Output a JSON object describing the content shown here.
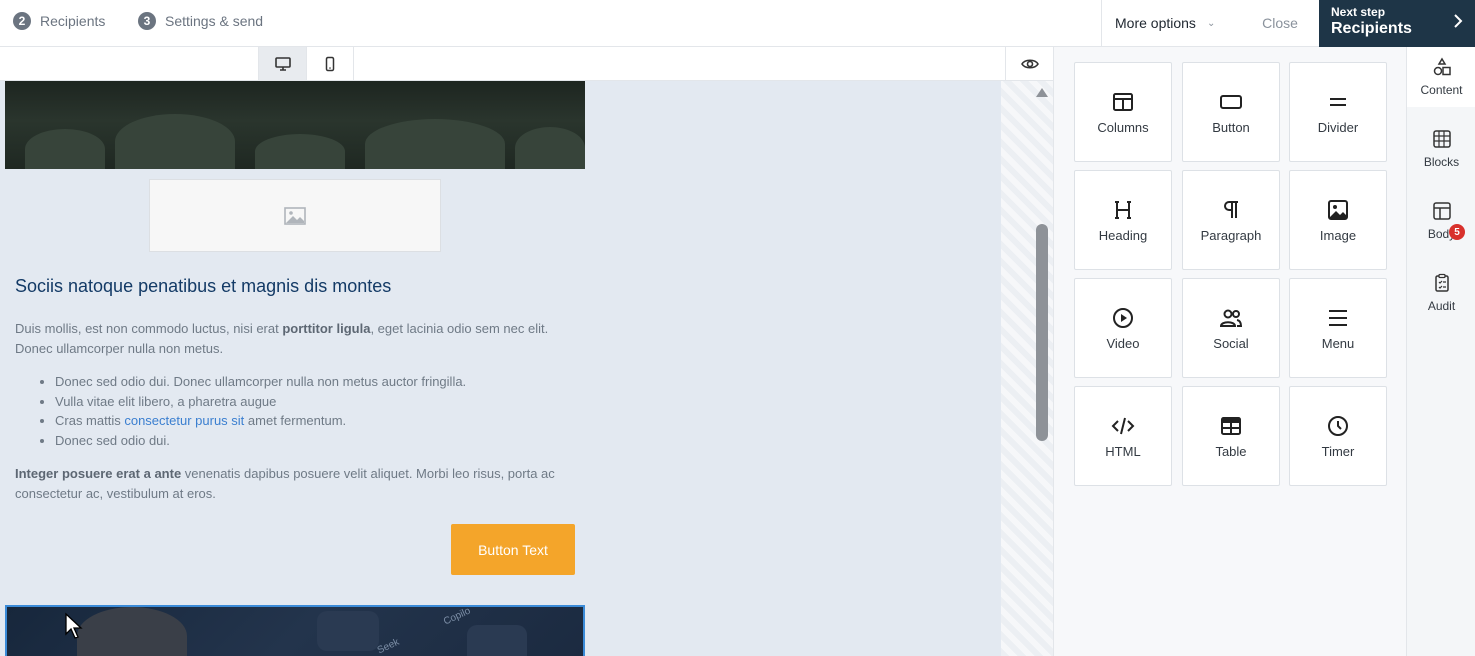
{
  "steps": [
    {
      "number": "2",
      "label": "Recipients"
    },
    {
      "number": "3",
      "label": "Settings & send"
    }
  ],
  "header": {
    "more_options_label": "More options",
    "close_label": "Close",
    "next_step_small": "Next step",
    "next_step_big": "Recipients"
  },
  "email": {
    "heading": "Sociis natoque penatibus et magnis dis montes",
    "para1_before": "Duis mollis, est non commodo luctus, nisi erat ",
    "para1_bold": "porttitor ligula",
    "para1_after": ", eget lacinia odio sem nec elit. Donec ullamcorper nulla non metus.",
    "list": {
      "item1": "Donec sed odio dui. Donec ullamcorper nulla non metus auctor fringilla.",
      "item2": "Vulla vitae elit libero, a pharetra augue",
      "item3_before": "Cras mattis ",
      "item3_link": "consectetur purus sit",
      "item3_after": " amet fermentum.",
      "item4": "Donec sed odio dui."
    },
    "para2_bold": "Integer posuere erat a ante",
    "para2_after": " venenatis dapibus posuere velit aliquet. Morbi leo risus, porta ac consectetur ac, vestibulum at eros.",
    "button_text": "Button Text",
    "image_tags": [
      "Seek",
      "Copilo"
    ]
  },
  "blocks": [
    {
      "label": "Columns",
      "icon": "columns-icon"
    },
    {
      "label": "Button",
      "icon": "button-icon"
    },
    {
      "label": "Divider",
      "icon": "divider-icon"
    },
    {
      "label": "Heading",
      "icon": "heading-icon"
    },
    {
      "label": "Paragraph",
      "icon": "paragraph-icon"
    },
    {
      "label": "Image",
      "icon": "image-icon"
    },
    {
      "label": "Video",
      "icon": "video-icon"
    },
    {
      "label": "Social",
      "icon": "social-icon"
    },
    {
      "label": "Menu",
      "icon": "menu-icon"
    },
    {
      "label": "HTML",
      "icon": "html-icon"
    },
    {
      "label": "Table",
      "icon": "table-icon"
    },
    {
      "label": "Timer",
      "icon": "timer-icon"
    }
  ],
  "rnav": {
    "content": "Content",
    "blocks": "Blocks",
    "body": "Body",
    "audit": "Audit",
    "audit_badge": "5"
  },
  "colors": {
    "accent_dark": "#1e3547",
    "button_orange": "#f4a52a",
    "canvas_bg": "#e3e9f1",
    "selection_blue": "#3b8bd8",
    "badge_red": "#d8312c"
  }
}
